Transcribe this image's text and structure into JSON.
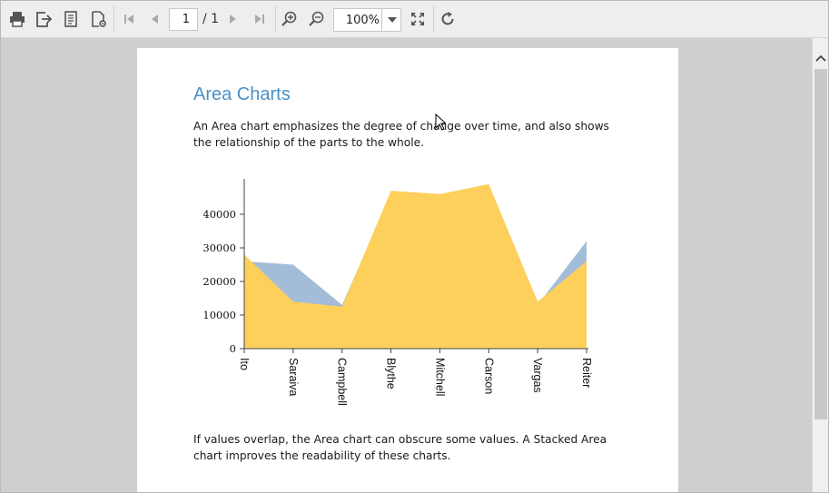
{
  "toolbar": {
    "current_page": "1",
    "page_total": "/ 1",
    "zoom": "100%"
  },
  "document": {
    "title": "Area Charts",
    "intro": "An Area chart emphasizes the degree of change over time, and also shows the relationship of the parts to the whole.",
    "outro": "If values overlap, the Area chart can obscure some values. A Stacked Area chart improves the readability of these charts."
  },
  "chart_data": {
    "type": "area",
    "categories": [
      "Ito",
      "Saraiva",
      "Campbell",
      "Blythe",
      "Mitchell",
      "Carson",
      "Vargas",
      "Reiter"
    ],
    "series": [
      {
        "values": [
          26000,
          25000,
          13000,
          46000,
          45000,
          48000,
          13000,
          32000
        ],
        "color": "#a3bdd8"
      },
      {
        "values": [
          28000,
          14000,
          12500,
          47000,
          46000,
          49000,
          14000,
          26000
        ],
        "color": "#fdd05c"
      }
    ],
    "yticks": [
      "0",
      "10000",
      "20000",
      "30000",
      "40000"
    ],
    "ylim": [
      0,
      50000
    ],
    "grid": false
  }
}
